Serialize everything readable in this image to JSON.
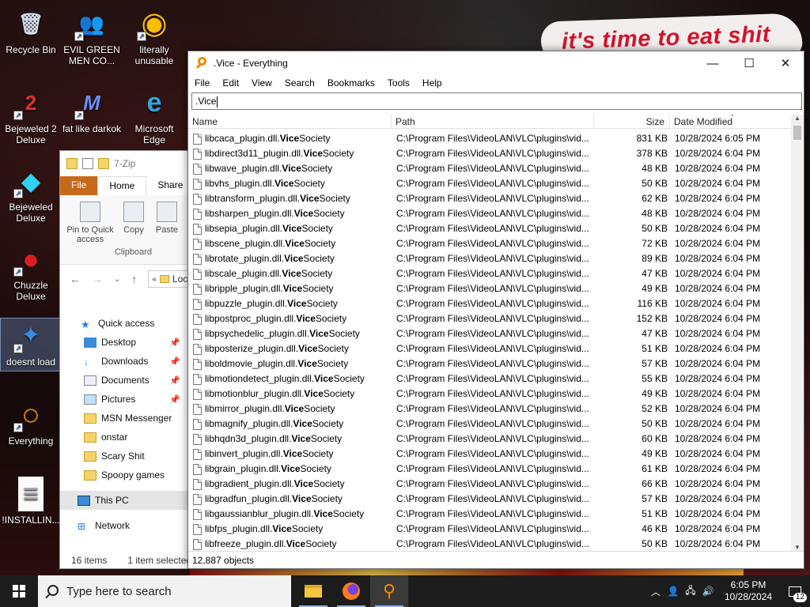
{
  "desktop": {
    "banner_text": "it's time to eat shit",
    "icons": [
      {
        "label": "Recycle Bin",
        "glyph": "🗑",
        "shortcut": false
      },
      {
        "label": "EVIL GREEN MEN CO...",
        "glyph": "👥",
        "shortcut": true
      },
      {
        "label": "literally unusable",
        "glyph": "◉",
        "shortcut": true
      },
      {
        "label": "Bejeweled 2 Deluxe",
        "glyph": "2",
        "shortcut": true
      },
      {
        "label": "fat like darkok",
        "glyph": "M",
        "shortcut": true
      },
      {
        "label": "Microsoft Edge",
        "glyph": "e",
        "shortcut": false
      },
      {
        "label": "Bejeweled Deluxe",
        "glyph": "◆",
        "shortcut": true
      },
      {
        "label": "Chuzzle Deluxe",
        "glyph": "●",
        "shortcut": true
      },
      {
        "label": "doesnt load",
        "glyph": "✦",
        "shortcut": true
      },
      {
        "label": "Everything",
        "glyph": "○",
        "shortcut": true
      },
      {
        "label": "!INSTALLIN...",
        "glyph": "≡",
        "shortcut": false
      }
    ]
  },
  "explorer": {
    "title": "7-Zip",
    "tabs": {
      "file": "File",
      "home": "Home",
      "share": "Share"
    },
    "ribbon": {
      "pin": "Pin to Quick access",
      "copy": "Copy",
      "paste": "Paste",
      "group": "Clipboard"
    },
    "address_text": "Loc",
    "tree": [
      {
        "label": "Quick access",
        "type": "star"
      },
      {
        "label": "Desktop",
        "type": "desktop",
        "pinned": true
      },
      {
        "label": "Downloads",
        "type": "download",
        "pinned": true
      },
      {
        "label": "Documents",
        "type": "doc",
        "pinned": true
      },
      {
        "label": "Pictures",
        "type": "pic",
        "pinned": true
      },
      {
        "label": "MSN Messenger",
        "type": "folder"
      },
      {
        "label": "onstar",
        "type": "folder"
      },
      {
        "label": "Scary Shit",
        "type": "folder"
      },
      {
        "label": "Spoopy games",
        "type": "folder"
      },
      {
        "label": "This PC",
        "type": "pc"
      },
      {
        "label": "Network",
        "type": "network"
      }
    ],
    "status": {
      "items": "16 items",
      "selected": "1 item selected"
    }
  },
  "everything": {
    "title": ".Vice - Everything",
    "menu": [
      "File",
      "Edit",
      "View",
      "Search",
      "Bookmarks",
      "Tools",
      "Help"
    ],
    "search_value": ".Vice",
    "columns": {
      "name": "Name",
      "path": "Path",
      "size": "Size",
      "date": "Date Modified"
    },
    "bold_part": "Vice",
    "rows": [
      {
        "prefix": "libcaca_plugin.dll.",
        "suffix": "Society",
        "path": "C:\\Program Files\\VideoLAN\\VLC\\plugins\\vid...",
        "size": "831 KB",
        "date": "10/28/2024 6:05 PM"
      },
      {
        "prefix": "libdirect3d11_plugin.dll.",
        "suffix": "Society",
        "path": "C:\\Program Files\\VideoLAN\\VLC\\plugins\\vid...",
        "size": "378 KB",
        "date": "10/28/2024 6:04 PM"
      },
      {
        "prefix": "libwave_plugin.dll.",
        "suffix": "Society",
        "path": "C:\\Program Files\\VideoLAN\\VLC\\plugins\\vid...",
        "size": "48 KB",
        "date": "10/28/2024 6:04 PM"
      },
      {
        "prefix": "libvhs_plugin.dll.",
        "suffix": "Society",
        "path": "C:\\Program Files\\VideoLAN\\VLC\\plugins\\vid...",
        "size": "50 KB",
        "date": "10/28/2024 6:04 PM"
      },
      {
        "prefix": "libtransform_plugin.dll.",
        "suffix": "Society",
        "path": "C:\\Program Files\\VideoLAN\\VLC\\plugins\\vid...",
        "size": "62 KB",
        "date": "10/28/2024 6:04 PM"
      },
      {
        "prefix": "libsharpen_plugin.dll.",
        "suffix": "Society",
        "path": "C:\\Program Files\\VideoLAN\\VLC\\plugins\\vid...",
        "size": "48 KB",
        "date": "10/28/2024 6:04 PM"
      },
      {
        "prefix": "libsepia_plugin.dll.",
        "suffix": "Society",
        "path": "C:\\Program Files\\VideoLAN\\VLC\\plugins\\vid...",
        "size": "50 KB",
        "date": "10/28/2024 6:04 PM"
      },
      {
        "prefix": "libscene_plugin.dll.",
        "suffix": "Society",
        "path": "C:\\Program Files\\VideoLAN\\VLC\\plugins\\vid...",
        "size": "72 KB",
        "date": "10/28/2024 6:04 PM"
      },
      {
        "prefix": "librotate_plugin.dll.",
        "suffix": "Society",
        "path": "C:\\Program Files\\VideoLAN\\VLC\\plugins\\vid...",
        "size": "89 KB",
        "date": "10/28/2024 6:04 PM"
      },
      {
        "prefix": "libscale_plugin.dll.",
        "suffix": "Society",
        "path": "C:\\Program Files\\VideoLAN\\VLC\\plugins\\vid...",
        "size": "47 KB",
        "date": "10/28/2024 6:04 PM"
      },
      {
        "prefix": "libripple_plugin.dll.",
        "suffix": "Society",
        "path": "C:\\Program Files\\VideoLAN\\VLC\\plugins\\vid...",
        "size": "49 KB",
        "date": "10/28/2024 6:04 PM"
      },
      {
        "prefix": "libpuzzle_plugin.dll.",
        "suffix": "Society",
        "path": "C:\\Program Files\\VideoLAN\\VLC\\plugins\\vid...",
        "size": "116 KB",
        "date": "10/28/2024 6:04 PM"
      },
      {
        "prefix": "libpostproc_plugin.dll.",
        "suffix": "Society",
        "path": "C:\\Program Files\\VideoLAN\\VLC\\plugins\\vid...",
        "size": "152 KB",
        "date": "10/28/2024 6:04 PM"
      },
      {
        "prefix": "libpsychedelic_plugin.dll.",
        "suffix": "Society",
        "path": "C:\\Program Files\\VideoLAN\\VLC\\plugins\\vid...",
        "size": "47 KB",
        "date": "10/28/2024 6:04 PM"
      },
      {
        "prefix": "libposterize_plugin.dll.",
        "suffix": "Society",
        "path": "C:\\Program Files\\VideoLAN\\VLC\\plugins\\vid...",
        "size": "51 KB",
        "date": "10/28/2024 6:04 PM"
      },
      {
        "prefix": "liboldmovie_plugin.dll.",
        "suffix": "Society",
        "path": "C:\\Program Files\\VideoLAN\\VLC\\plugins\\vid...",
        "size": "57 KB",
        "date": "10/28/2024 6:04 PM"
      },
      {
        "prefix": "libmotiondetect_plugin.dll.",
        "suffix": "Society",
        "path": "C:\\Program Files\\VideoLAN\\VLC\\plugins\\vid...",
        "size": "55 KB",
        "date": "10/28/2024 6:04 PM"
      },
      {
        "prefix": "libmotionblur_plugin.dll.",
        "suffix": "Society",
        "path": "C:\\Program Files\\VideoLAN\\VLC\\plugins\\vid...",
        "size": "49 KB",
        "date": "10/28/2024 6:04 PM"
      },
      {
        "prefix": "libmirror_plugin.dll.",
        "suffix": "Society",
        "path": "C:\\Program Files\\VideoLAN\\VLC\\plugins\\vid...",
        "size": "52 KB",
        "date": "10/28/2024 6:04 PM"
      },
      {
        "prefix": "libmagnify_plugin.dll.",
        "suffix": "Society",
        "path": "C:\\Program Files\\VideoLAN\\VLC\\plugins\\vid...",
        "size": "50 KB",
        "date": "10/28/2024 6:04 PM"
      },
      {
        "prefix": "libhqdn3d_plugin.dll.",
        "suffix": "Society",
        "path": "C:\\Program Files\\VideoLAN\\VLC\\plugins\\vid...",
        "size": "60 KB",
        "date": "10/28/2024 6:04 PM"
      },
      {
        "prefix": "libinvert_plugin.dll.",
        "suffix": "Society",
        "path": "C:\\Program Files\\VideoLAN\\VLC\\plugins\\vid...",
        "size": "49 KB",
        "date": "10/28/2024 6:04 PM"
      },
      {
        "prefix": "libgrain_plugin.dll.",
        "suffix": "Society",
        "path": "C:\\Program Files\\VideoLAN\\VLC\\plugins\\vid...",
        "size": "61 KB",
        "date": "10/28/2024 6:04 PM"
      },
      {
        "prefix": "libgradient_plugin.dll.",
        "suffix": "Society",
        "path": "C:\\Program Files\\VideoLAN\\VLC\\plugins\\vid...",
        "size": "66 KB",
        "date": "10/28/2024 6:04 PM"
      },
      {
        "prefix": "libgradfun_plugin.dll.",
        "suffix": "Society",
        "path": "C:\\Program Files\\VideoLAN\\VLC\\plugins\\vid...",
        "size": "57 KB",
        "date": "10/28/2024 6:04 PM"
      },
      {
        "prefix": "libgaussianblur_plugin.dll.",
        "suffix": "Society",
        "path": "C:\\Program Files\\VideoLAN\\VLC\\plugins\\vid...",
        "size": "51 KB",
        "date": "10/28/2024 6:04 PM"
      },
      {
        "prefix": "libfps_plugin.dll.",
        "suffix": "Society",
        "path": "C:\\Program Files\\VideoLAN\\VLC\\plugins\\vid...",
        "size": "46 KB",
        "date": "10/28/2024 6:04 PM"
      },
      {
        "prefix": "libfreeze_plugin.dll.",
        "suffix": "Society",
        "path": "C:\\Program Files\\VideoLAN\\VLC\\plugins\\vid...",
        "size": "50 KB",
        "date": "10/28/2024 6:04 PM"
      }
    ],
    "status": "12,887 objects"
  },
  "taskbar": {
    "search_placeholder": "Type here to search",
    "time": "6:05 PM",
    "date": "10/28/2024",
    "notification_count": "12"
  },
  "colors": {
    "accent_orange": "#f08a00",
    "banner_red": "#d2142b",
    "explorer_file_tab": "#c56a1a",
    "taskbar": "#1c1c1c"
  }
}
